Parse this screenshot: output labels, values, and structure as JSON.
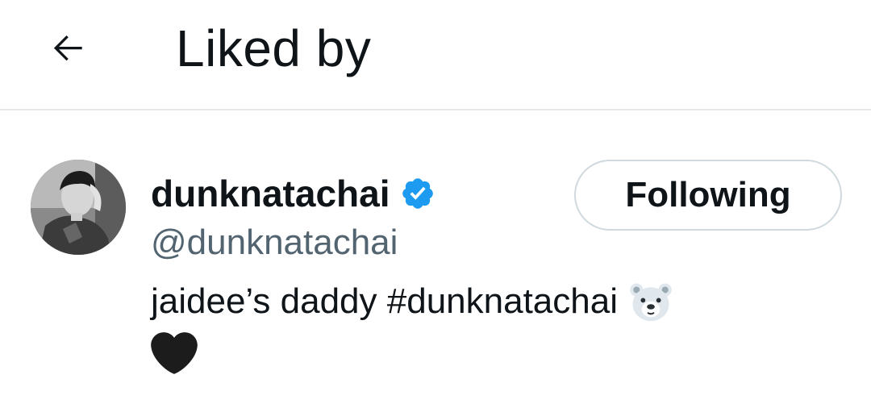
{
  "header": {
    "back_icon": "arrow-left-icon",
    "title": "Liked by"
  },
  "users": [
    {
      "display_name": "dunknatachai",
      "verified": true,
      "verified_color": "#1d9bf0",
      "handle": "@dunknatachai",
      "follow_label": "Following",
      "bio": "jaidee’s daddy #dunknatachai",
      "bio_emojis": [
        "polar-bear-face-emoji",
        "black-heart-emoji"
      ]
    }
  ]
}
